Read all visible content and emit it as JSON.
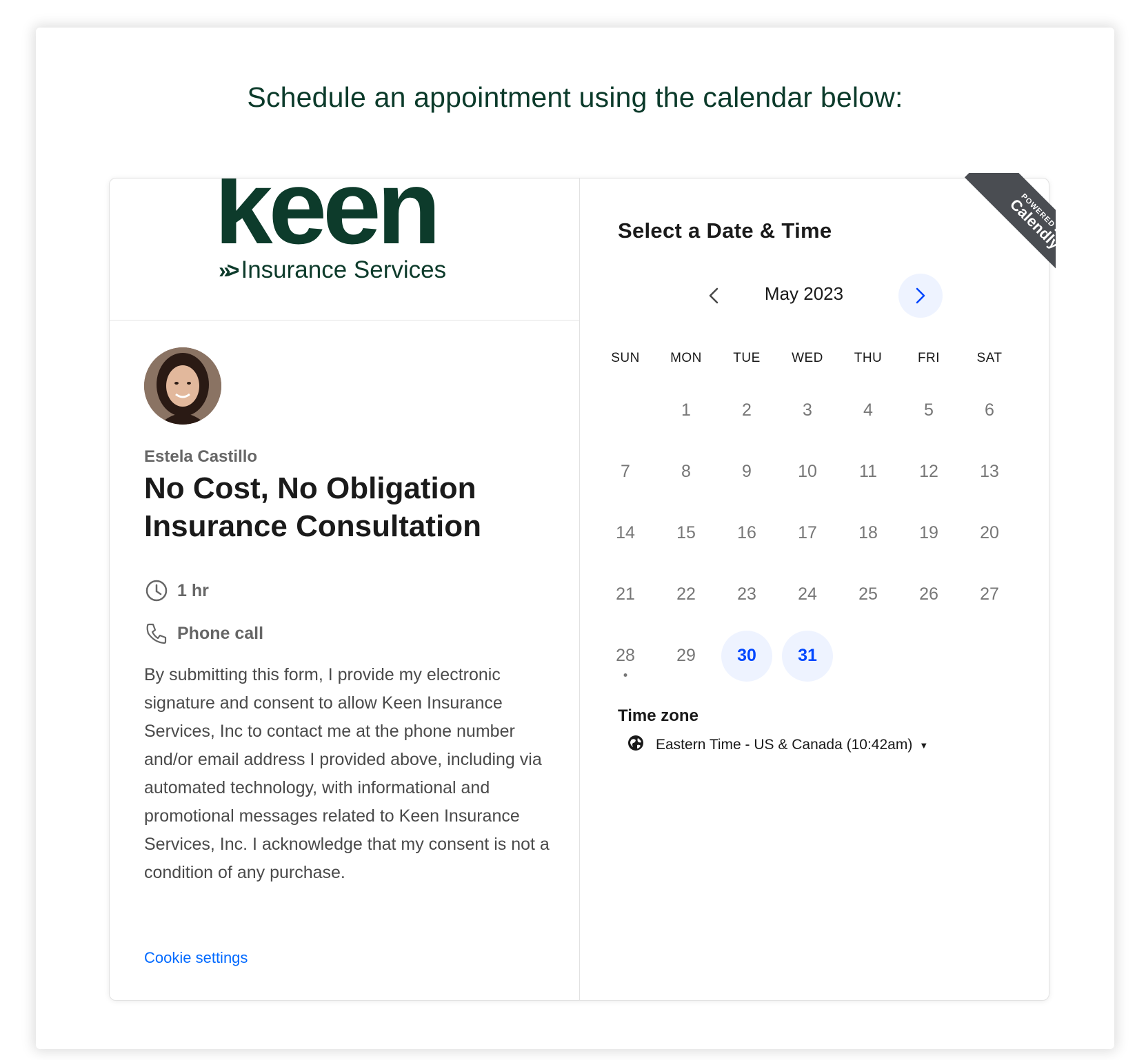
{
  "page": {
    "heading": "Schedule an appointment using the calendar below:"
  },
  "logo": {
    "word": "keen",
    "chevrons": "»>",
    "subtitle": "Insurance Services"
  },
  "host": {
    "name": "Estela Castillo",
    "avatar_icon": "person-avatar"
  },
  "event": {
    "title": "No Cost, No Obligation Insurance Consultation",
    "duration": "1 hr",
    "location": "Phone call",
    "duration_icon": "clock-icon",
    "location_icon": "phone-icon"
  },
  "consent": {
    "text": "By submitting this form, I provide my electronic signature and consent to allow Keen Insurance Services, Inc to contact me at the phone number and/or email address I provided above, including via automated technology, with informational and promotional messages related to Keen Insurance Services, Inc. I acknowledge that my consent is not a condition of any purchase."
  },
  "links": {
    "cookie_settings": "Cookie settings"
  },
  "scheduler": {
    "title": "Select a Date & Time",
    "month_label": "May 2023",
    "weekdays": [
      "SUN",
      "MON",
      "TUE",
      "WED",
      "THU",
      "FRI",
      "SAT"
    ],
    "first_weekday_index": 1,
    "days_in_month": 31,
    "today": 28,
    "available_days": [
      30,
      31
    ],
    "timezone_label": "Time zone",
    "timezone_value": "Eastern Time - US & Canada (10:42am)"
  },
  "ribbon": {
    "small": "POWERED BY",
    "big": "Calendly"
  },
  "colors": {
    "brand_green": "#0d3b2b",
    "accent_blue": "#0047ff",
    "available_bg": "#eef3ff",
    "ribbon_bg": "#4a4d52"
  }
}
